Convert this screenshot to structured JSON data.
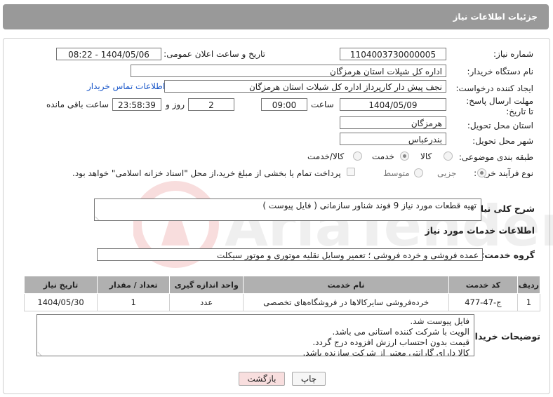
{
  "header": {
    "title": "جزئیات اطلاعات نیاز"
  },
  "form": {
    "need_number": {
      "label": "شماره نیاز:",
      "value": "1104003730000005"
    },
    "announce": {
      "label": "تاریخ و ساعت اعلان عمومی:",
      "value": "1404/05/06 - 08:22"
    },
    "buyer_org": {
      "label": "نام دستگاه خریدار:",
      "value": "اداره کل شیلات استان هرمزگان"
    },
    "requester": {
      "label": "ایجاد کننده درخواست:",
      "value": "نجف پیش دار کارپرداز اداره کل شیلات استان هرمزگان"
    },
    "contact_link": "اطلاعات تماس خریدار",
    "deadline": {
      "label": "مهلت ارسال پاسخ: تا تاریخ:",
      "date": "1404/05/09",
      "time_label": "ساعت",
      "time": "09:00",
      "days": "2",
      "days_label": "روز و",
      "remaining": "23:58:39",
      "remaining_label": "ساعت باقی مانده"
    },
    "province": {
      "label": "استان محل تحویل:",
      "value": "هرمزگان"
    },
    "city": {
      "label": "شهر محل تحویل:",
      "value": "بندرعباس"
    },
    "category": {
      "label": "طبقه بندی موضوعی:",
      "options": [
        "کالا",
        "خدمت",
        "کالا/خدمت"
      ],
      "selected": "خدمت"
    },
    "process": {
      "label": "نوع فرآیند خرید :",
      "options": [
        "جزیی",
        "متوسط"
      ],
      "selected": "جزیی",
      "note": "پرداخت تمام یا بخشی از مبلغ خرید،از محل \"اسناد خزانه اسلامی\" خواهد بود."
    }
  },
  "summary": {
    "label": "شرح کلی نیاز:",
    "value": "تهیه قطعات مورد نیاز 9 فوند شناور سازمانی ( فایل پیوست )"
  },
  "services_title": "اطلاعات خدمات مورد نیاز",
  "service_group": {
    "label": "گروه خدمت:",
    "value": "عمده فروشی و خرده فروشی ؛ تعمیر وسایل نقلیه موتوری و موتور سیکلت"
  },
  "table": {
    "headers": [
      "ردیف",
      "کد خدمت",
      "نام خدمت",
      "واحد اندازه گیری",
      "تعداد / مقدار",
      "تاریخ نیاز"
    ],
    "rows": [
      [
        "1",
        "ج-47-477",
        "خرده‌فروشی سایرکالاها در فروشگاه‌های تخصصی",
        "عدد",
        "1",
        "1404/05/30"
      ]
    ]
  },
  "buyer_notes": {
    "label": "توضیحات خریدار:",
    "lines": [
      "فایل پیوست شد.",
      "الویت با شرکت کننده استانی می باشد.",
      "قیمت بدون احتساب ارزش افزوده درج گردد.",
      "کالا دارای گارانتی معتبر  از شرکت سازنده باشد."
    ]
  },
  "buttons": {
    "print": "چاپ",
    "back": "بازگشت"
  },
  "colors": {
    "header_bg": "#999999",
    "table_header_bg": "#b0b0b0",
    "link": "#1a57c9",
    "back_button_bg": "#f8dede"
  }
}
